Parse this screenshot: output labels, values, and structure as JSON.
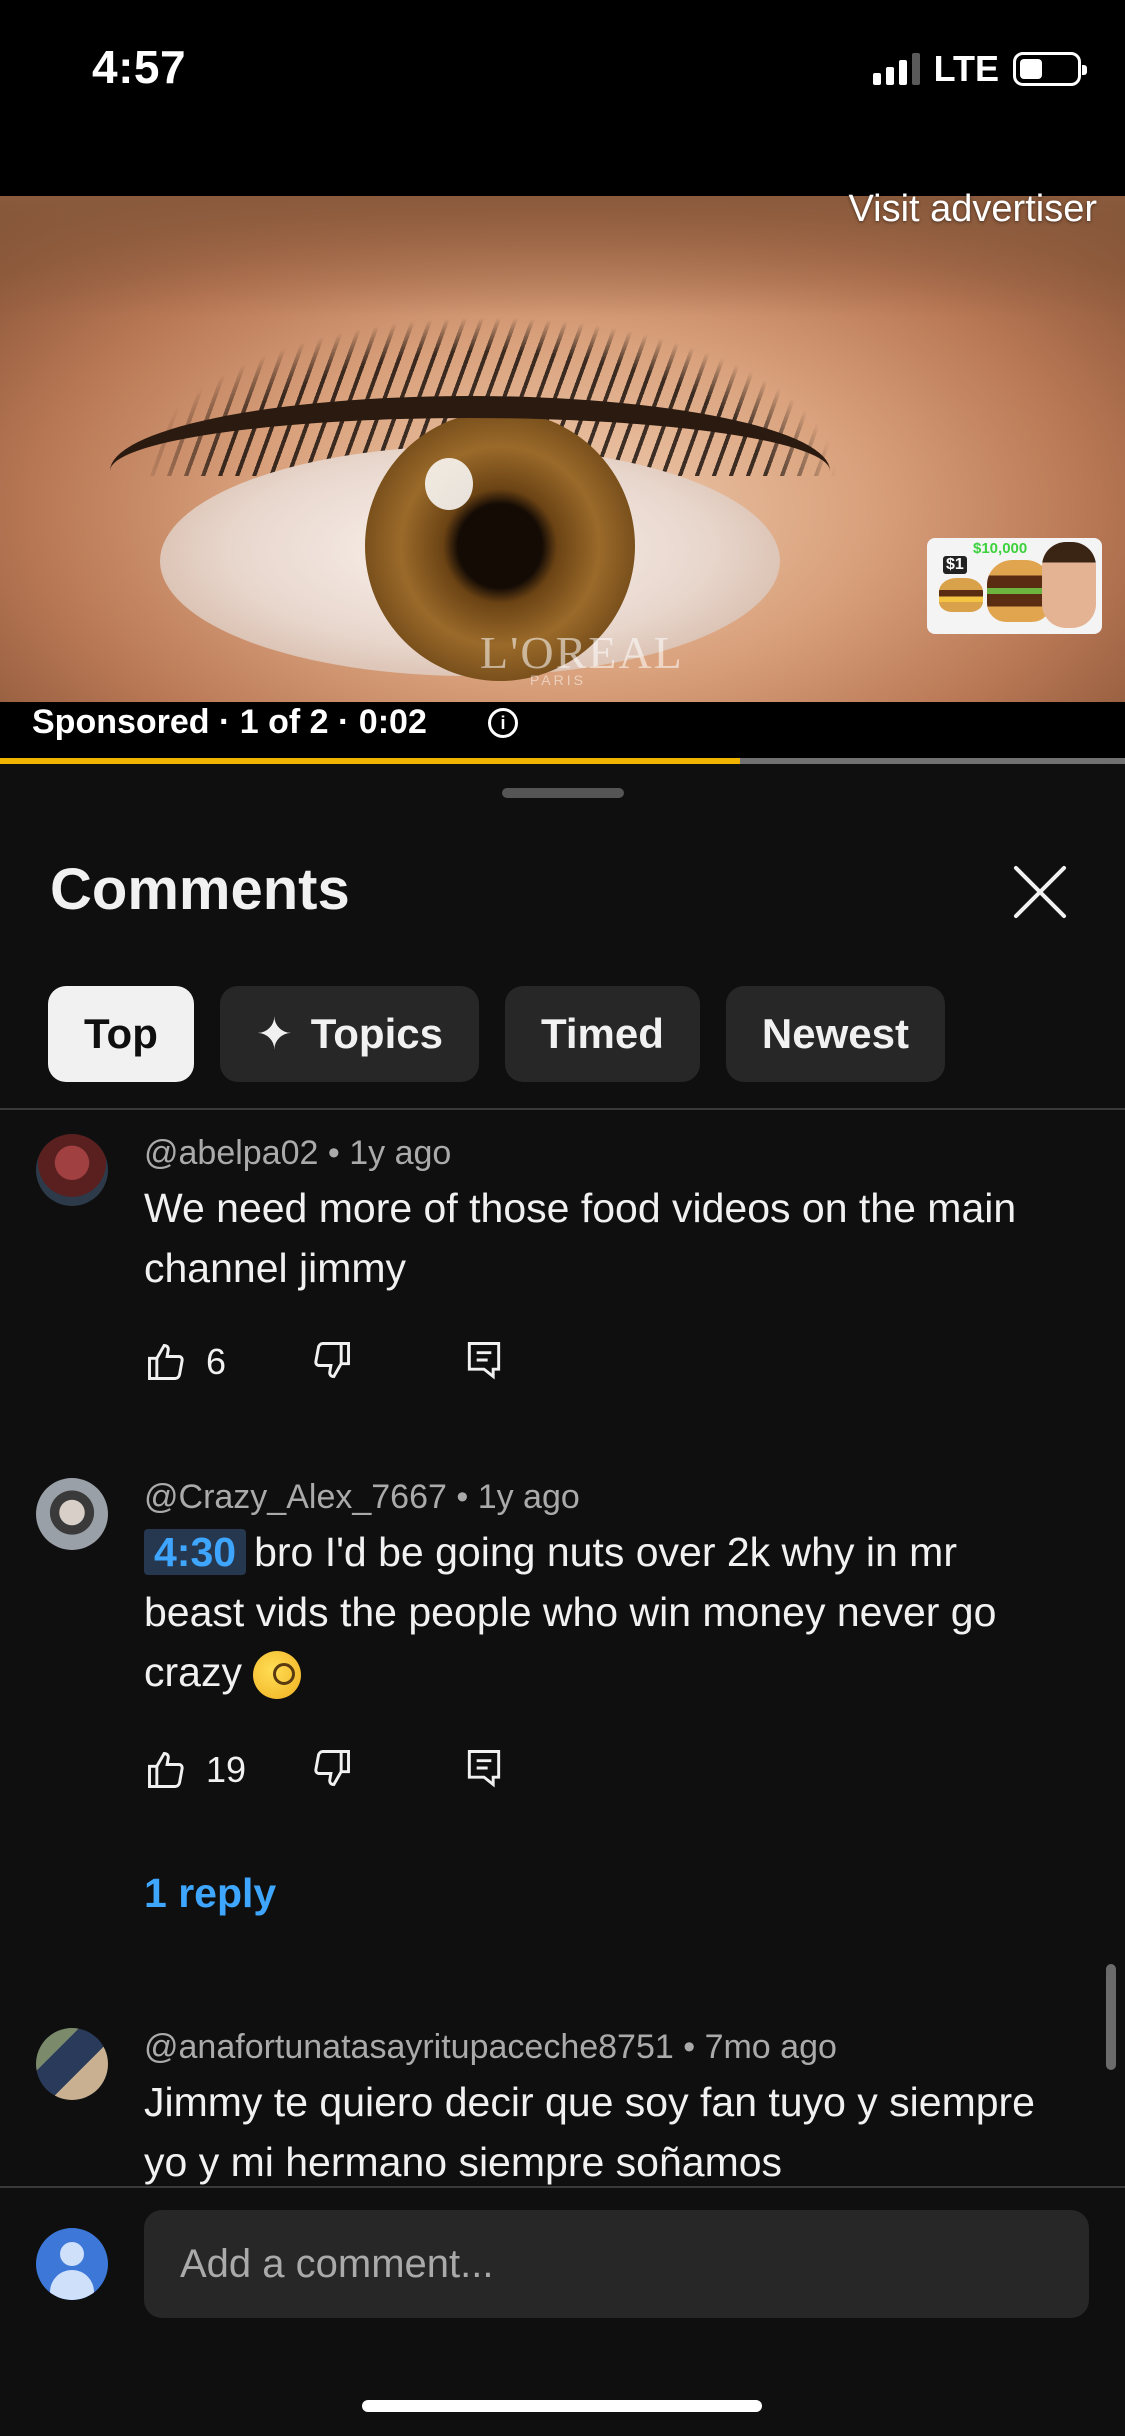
{
  "status": {
    "time": "4:57",
    "network": "LTE",
    "battery_percent": 40
  },
  "ad": {
    "visit_label": "Visit advertiser",
    "brand": "L'OREAL",
    "brand_sub": "PARIS",
    "thumbnail": {
      "price_low": "$1",
      "price_high": "$10,000"
    },
    "sponsored_label": "Sponsored · 1 of 2 · 0:02",
    "info_glyph": "i",
    "progress_percent": 65.8
  },
  "comments_panel": {
    "title": "Comments",
    "filters": [
      {
        "label": "Top",
        "active": true
      },
      {
        "label": "Topics",
        "icon": "sparkle-icon"
      },
      {
        "label": "Timed"
      },
      {
        "label": "Newest"
      }
    ],
    "items": [
      {
        "author_time": "@abelpa02 • 1y ago",
        "text": "We need more of those food videos on the main channel jimmy",
        "likes": "6"
      },
      {
        "author_time": "@Crazy_Alex_7667 • 1y ago",
        "timestamp": "4:30",
        "text": "bro I'd be going nuts over 2k why in mr beast vids the people who win money never go crazy",
        "likes": "19",
        "reply_label": "1 reply"
      },
      {
        "author_time": "@anafortunatasayritupaceche8751 • 7mo ago",
        "text": "Jimmy te quiero decir que soy fan tuyo y siempre yo y mi  hermano siempre soñamos"
      }
    ],
    "composer": {
      "placeholder": "Add a comment..."
    }
  },
  "colors": {
    "accent_link": "#3ea6ff",
    "progress": "#f0b400",
    "background": "#0f0f0f"
  }
}
